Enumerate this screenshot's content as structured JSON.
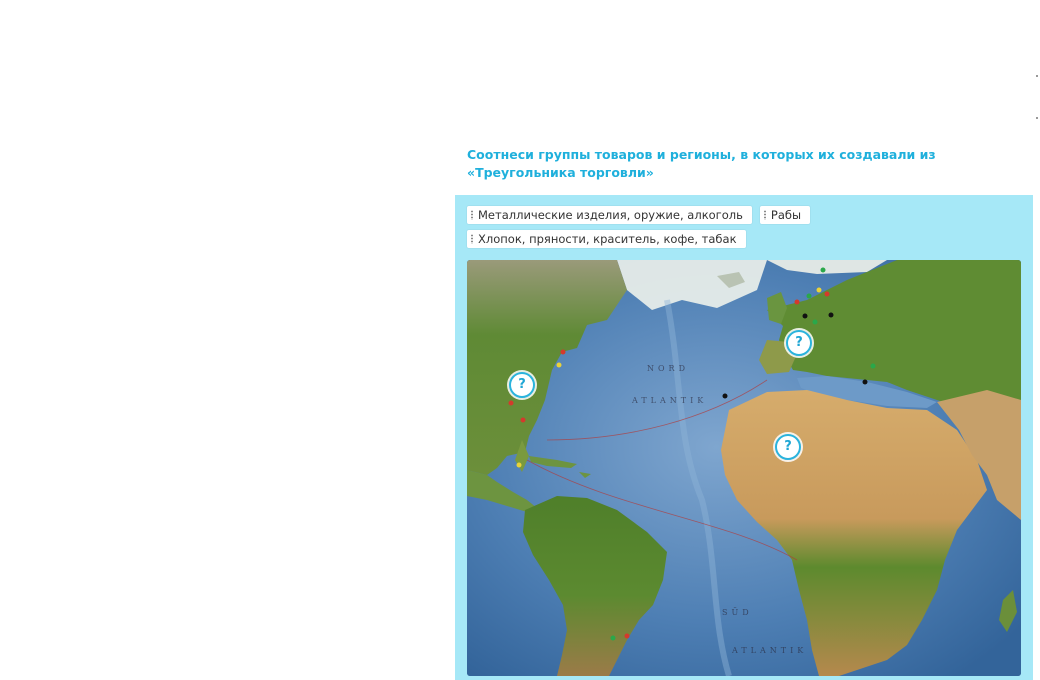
{
  "task": {
    "title": "Соотнеси группы товаров и регионы, в которых их создавали из «Треугольника торговли»"
  },
  "chips": [
    {
      "label": "Металлические изделия, оружие, алкоголь"
    },
    {
      "label": "Рабы"
    },
    {
      "label": "Хлопок, пряности, краситель, кофе, табак"
    }
  ],
  "map": {
    "labels": {
      "nord": "NORD",
      "atlantik": "ATLANTIK",
      "sud": "SÜD",
      "atlantik_south": "ATLANTIK"
    },
    "hotspots": [
      {
        "label": "?",
        "region": "North America"
      },
      {
        "label": "?",
        "region": "Europe"
      },
      {
        "label": "?",
        "region": "Africa"
      }
    ]
  },
  "colors": {
    "accent": "#1fb0dc",
    "panel": "#a6e8f7",
    "ocean": "#3f72a8",
    "land_green": "#4f7f2a",
    "land_desert": "#c99a58"
  }
}
